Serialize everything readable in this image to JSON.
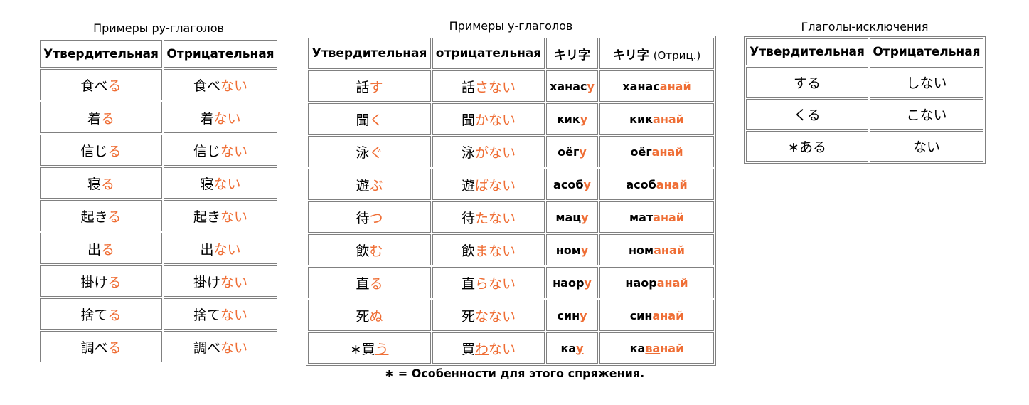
{
  "ru": {
    "caption": "Примеры ру-глаголов",
    "headers": [
      "Утвердительная",
      "Отрицательная"
    ],
    "rows": [
      {
        "a": [
          "食べ",
          "る"
        ],
        "n": [
          "食べ",
          "ない"
        ]
      },
      {
        "a": [
          "着",
          "る"
        ],
        "n": [
          "着",
          "ない"
        ]
      },
      {
        "a": [
          "信じ",
          "る"
        ],
        "n": [
          "信じ",
          "ない"
        ]
      },
      {
        "a": [
          "寝",
          "る"
        ],
        "n": [
          "寝",
          "ない"
        ]
      },
      {
        "a": [
          "起き",
          "る"
        ],
        "n": [
          "起き",
          "ない"
        ]
      },
      {
        "a": [
          "出",
          "る"
        ],
        "n": [
          "出",
          "ない"
        ]
      },
      {
        "a": [
          "掛け",
          "る"
        ],
        "n": [
          "掛け",
          "ない"
        ]
      },
      {
        "a": [
          "捨て",
          "る"
        ],
        "n": [
          "捨て",
          "ない"
        ]
      },
      {
        "a": [
          "調べ",
          "る"
        ],
        "n": [
          "調べ",
          "ない"
        ]
      }
    ]
  },
  "u": {
    "caption": "Примеры у-глаголов",
    "headers": [
      "Утвердительная",
      "отрицательная",
      "キリ字",
      "キリ字",
      "(Отриц.)"
    ],
    "rows": [
      {
        "a": [
          "話",
          "す"
        ],
        "n": [
          "話",
          "さない"
        ],
        "k": [
          "ханас",
          "у"
        ],
        "kn": [
          "ханас",
          "анай"
        ]
      },
      {
        "a": [
          "聞",
          "く"
        ],
        "n": [
          "聞",
          "かない"
        ],
        "k": [
          "кик",
          "у"
        ],
        "kn": [
          "кик",
          "анай"
        ]
      },
      {
        "a": [
          "泳",
          "ぐ"
        ],
        "n": [
          "泳",
          "がない"
        ],
        "k": [
          "оёг",
          "у"
        ],
        "kn": [
          "оёг",
          "анай"
        ]
      },
      {
        "a": [
          "遊",
          "ぶ"
        ],
        "n": [
          "遊",
          "ばない"
        ],
        "k": [
          "асоб",
          "у"
        ],
        "kn": [
          "асоб",
          "анай"
        ]
      },
      {
        "a": [
          "待",
          "つ"
        ],
        "n": [
          "待",
          "たない"
        ],
        "k": [
          "мац",
          "у"
        ],
        "kn": [
          "мат",
          "анай"
        ]
      },
      {
        "a": [
          "飲",
          "む"
        ],
        "n": [
          "飲",
          "まない"
        ],
        "k": [
          "ном",
          "у"
        ],
        "kn": [
          "ном",
          "анай"
        ]
      },
      {
        "a": [
          "直",
          "る"
        ],
        "n": [
          "直",
          "らない"
        ],
        "k": [
          "наор",
          "у"
        ],
        "kn": [
          "наор",
          "анай"
        ]
      },
      {
        "a": [
          "死",
          "ぬ"
        ],
        "n": [
          "死",
          "なない"
        ],
        "k": [
          "син",
          "у"
        ],
        "kn": [
          "син",
          "анай"
        ]
      },
      {
        "a": [
          "∗買",
          "う"
        ],
        "n": [
          "買",
          "わ",
          "ない"
        ],
        "k": [
          "ка",
          "у"
        ],
        "kn": [
          "ка",
          "ва",
          "най"
        ]
      }
    ]
  },
  "ex": {
    "caption": "Глаголы-исключения",
    "headers": [
      "Утвердительная",
      "Отрицательная"
    ],
    "rows": [
      {
        "a": "する",
        "n": "しない"
      },
      {
        "a": "くる",
        "n": "こない"
      },
      {
        "a": "∗ある",
        "n": "ない"
      }
    ]
  },
  "note": "∗ = Особенности для этого спряжения.",
  "colors": {
    "accent": "#ef6e35",
    "border": "#808080"
  }
}
